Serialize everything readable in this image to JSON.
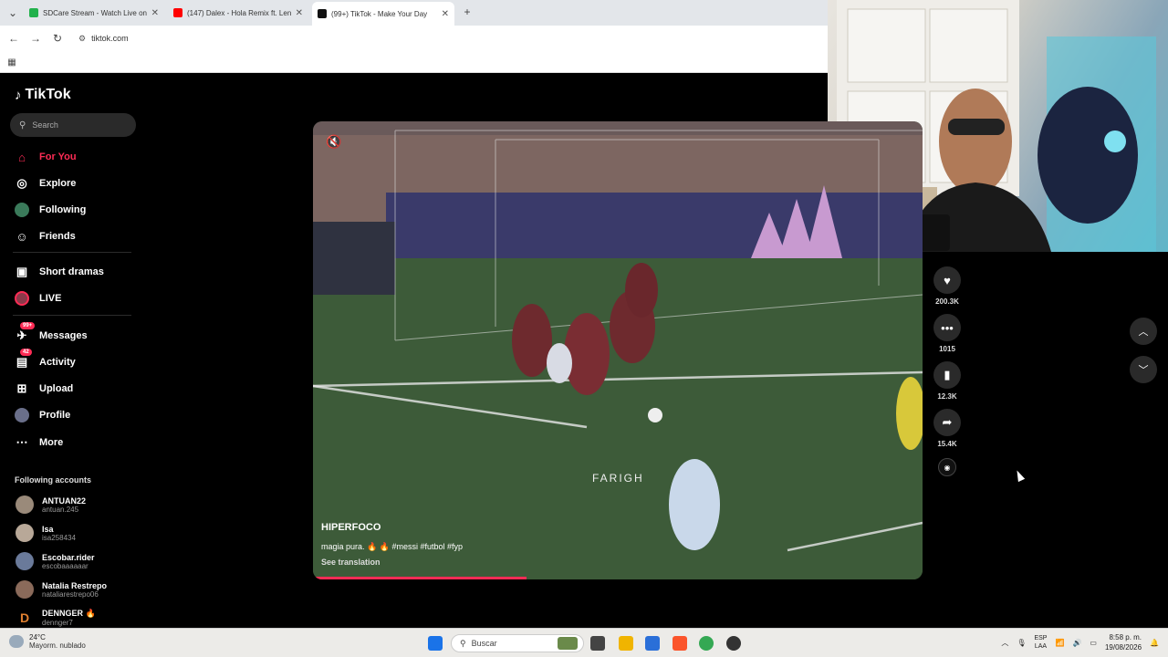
{
  "browser": {
    "tabs": [
      {
        "title": "SDCare Stream - Watch Live on",
        "favicon_color": "#22b14c"
      },
      {
        "title": "(147) Dalex - Hola Remix ft. Len",
        "favicon_color": "#ff0000"
      },
      {
        "title": "(99+) TikTok - Make Your Day",
        "favicon_color": "#111111"
      }
    ],
    "new_tab_label": "+",
    "url": "tiktok.com"
  },
  "sidebar": {
    "logo": "TikTok",
    "search_placeholder": "Search",
    "nav": [
      {
        "label": "For You",
        "icon": "home-icon",
        "active": true
      },
      {
        "label": "Explore",
        "icon": "compass-icon"
      },
      {
        "label": "Following",
        "icon": "following-icon"
      },
      {
        "label": "Friends",
        "icon": "friends-icon"
      },
      {
        "label": "Short dramas",
        "icon": "film-icon"
      },
      {
        "label": "LIVE",
        "icon": "live-icon"
      },
      {
        "label": "Messages",
        "icon": "messages-icon",
        "badge": "99+"
      },
      {
        "label": "Activity",
        "icon": "activity-icon",
        "badge": "42"
      },
      {
        "label": "Upload",
        "icon": "upload-icon"
      },
      {
        "label": "Profile",
        "icon": "profile-icon"
      },
      {
        "label": "More",
        "icon": "more-icon"
      }
    ],
    "following_title": "Following accounts",
    "accounts": [
      {
        "name": "ANTUAN22",
        "handle": "antuan.245"
      },
      {
        "name": "Isa",
        "handle": "isa258434"
      },
      {
        "name": "Escobar.rider",
        "handle": "escobaaaaaar"
      },
      {
        "name": "Natalia Restrepo",
        "handle": "nataliarestrepo06"
      },
      {
        "name": "DENNGER 🔥",
        "handle": "dennger7"
      }
    ]
  },
  "video": {
    "watermark": "FARIGH",
    "author": "HIPERFOCO",
    "caption": "magia pura. 🔥 🔥 #messi #futbol #fyp",
    "see_translation": "See translation",
    "progress": 0.35
  },
  "actions": {
    "likes": "200.3K",
    "comments": "1015",
    "saves": "12.3K",
    "shares": "15.4K"
  },
  "taskbar": {
    "weather_temp": "24°C",
    "weather_desc": "Mayorm. nublado",
    "search_placeholder": "Buscar",
    "lang_top": "ESP",
    "lang_bottom": "LAA",
    "time": "8:58 p. m.",
    "date": "19/08/2026"
  }
}
